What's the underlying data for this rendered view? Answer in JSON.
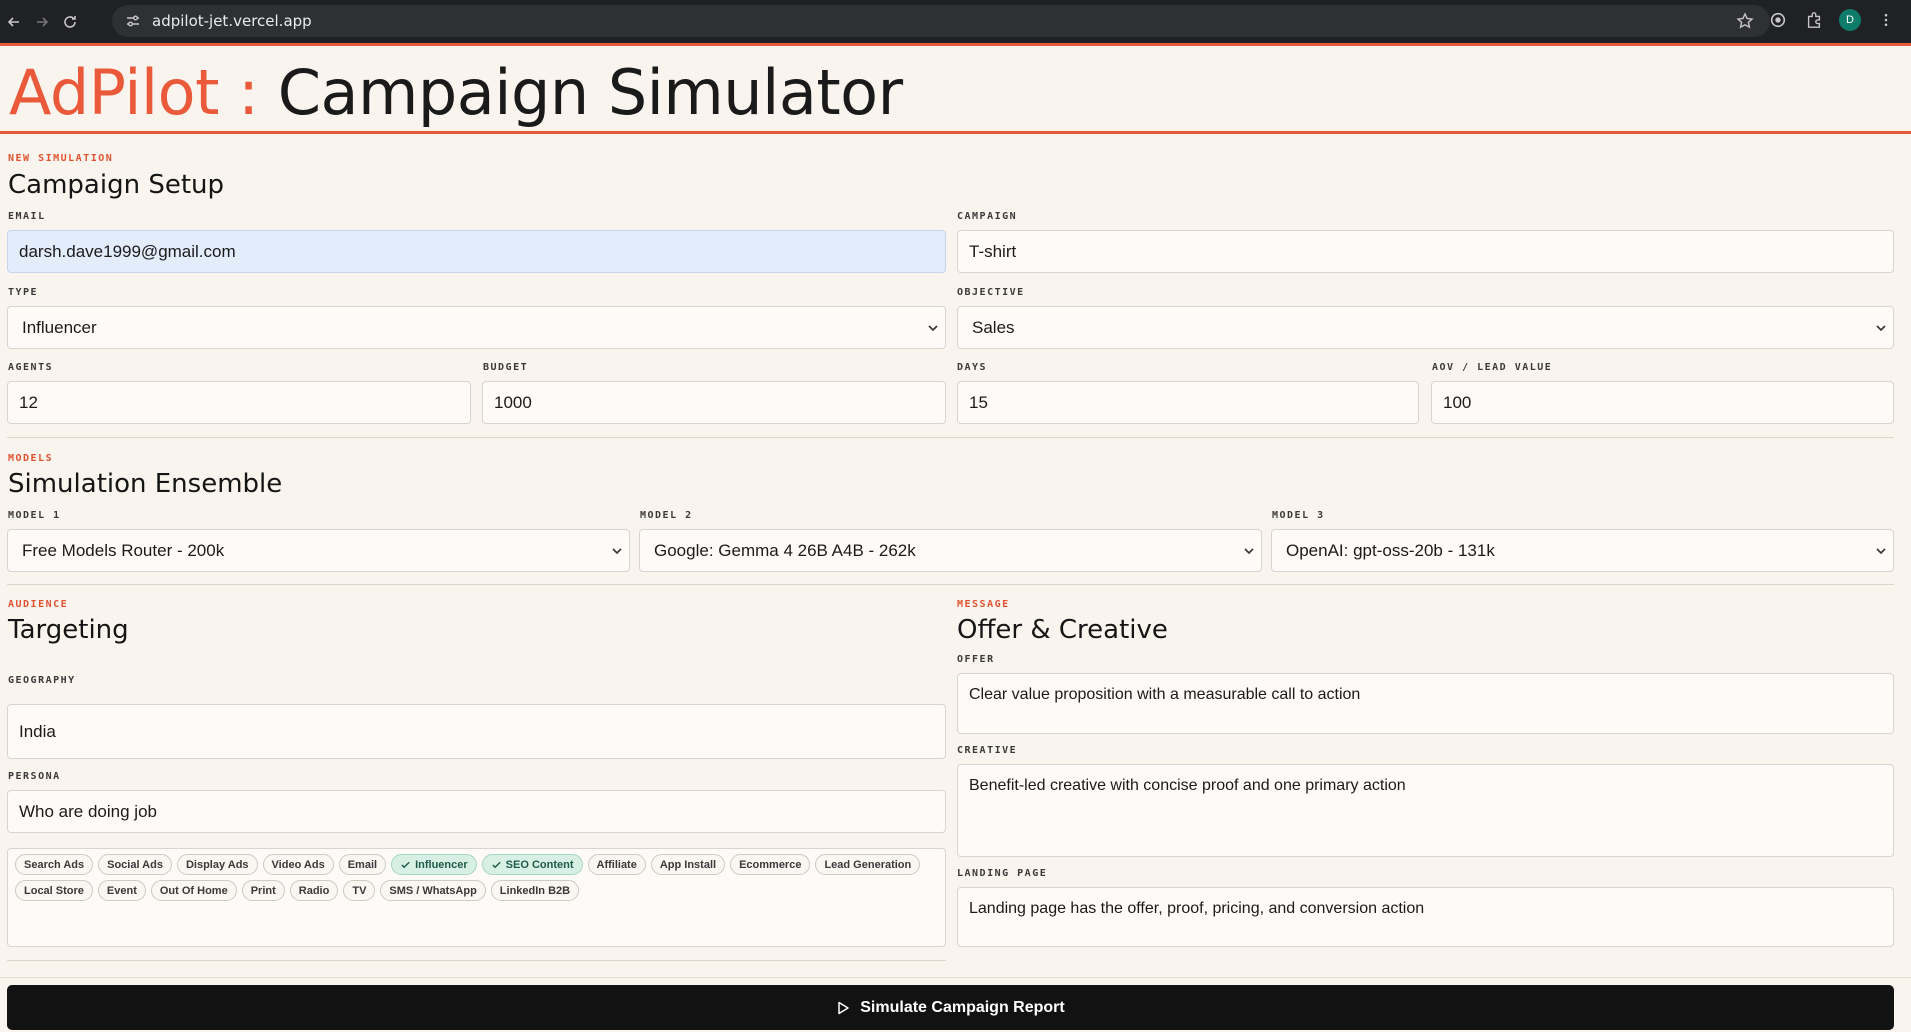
{
  "browser": {
    "url": "adpilot-jet.vercel.app",
    "profile_initial": "D"
  },
  "header": {
    "brand": "AdPilot :",
    "title": "Campaign Simulator"
  },
  "setup": {
    "eyebrow": "NEW SIMULATION",
    "title": "Campaign Setup",
    "email_label": "EMAIL",
    "email_value": "darsh.dave1999@gmail.com",
    "campaign_label": "CAMPAIGN",
    "campaign_value": "T-shirt",
    "type_label": "TYPE",
    "type_value": "Influencer",
    "objective_label": "OBJECTIVE",
    "objective_value": "Sales",
    "agents_label": "AGENTS",
    "agents_value": "12",
    "budget_label": "BUDGET",
    "budget_value": "1000",
    "days_label": "DAYS",
    "days_value": "15",
    "aov_label": "AOV / LEAD VALUE",
    "aov_value": "100"
  },
  "models": {
    "eyebrow": "MODELS",
    "title": "Simulation Ensemble",
    "model1_label": "MODEL 1",
    "model1_value": "Free Models Router - 200k",
    "model2_label": "MODEL 2",
    "model2_value": "Google: Gemma 4 26B A4B - 262k",
    "model3_label": "MODEL 3",
    "model3_value": "OpenAI: gpt-oss-20b - 131k"
  },
  "audience": {
    "eyebrow": "AUDIENCE",
    "title": "Targeting",
    "geography_label": "GEOGRAPHY",
    "geography_value": "India",
    "persona_label": "PERSONA",
    "persona_value": "Who are doing job",
    "channels": [
      {
        "label": "Search Ads",
        "selected": false
      },
      {
        "label": "Social Ads",
        "selected": false
      },
      {
        "label": "Display Ads",
        "selected": false
      },
      {
        "label": "Video Ads",
        "selected": false
      },
      {
        "label": "Email",
        "selected": false
      },
      {
        "label": "Influencer",
        "selected": true
      },
      {
        "label": "SEO Content",
        "selected": true
      },
      {
        "label": "Affiliate",
        "selected": false
      },
      {
        "label": "App Install",
        "selected": false
      },
      {
        "label": "Ecommerce",
        "selected": false
      },
      {
        "label": "Lead Generation",
        "selected": false
      },
      {
        "label": "Local Store",
        "selected": false
      },
      {
        "label": "Event",
        "selected": false
      },
      {
        "label": "Out Of Home",
        "selected": false
      },
      {
        "label": "Print",
        "selected": false
      },
      {
        "label": "Radio",
        "selected": false
      },
      {
        "label": "TV",
        "selected": false
      },
      {
        "label": "SMS / WhatsApp",
        "selected": false
      },
      {
        "label": "LinkedIn B2B",
        "selected": false
      }
    ]
  },
  "message": {
    "eyebrow": "MESSAGE",
    "title": "Offer & Creative",
    "offer_label": "OFFER",
    "offer_value": "Clear value proposition with a measurable call to action",
    "creative_label": "CREATIVE",
    "creative_value": "Benefit-led creative with concise proof and one primary action",
    "landing_label": "LANDING PAGE",
    "landing_value": "Landing page has the offer, proof, pricing, and conversion action"
  },
  "actions": {
    "simulate_label": "Simulate Campaign Report"
  },
  "colors": {
    "accent": "#e8583a",
    "background": "#faf4ee",
    "chip_selected": "#d8efe6",
    "button": "#121212"
  }
}
